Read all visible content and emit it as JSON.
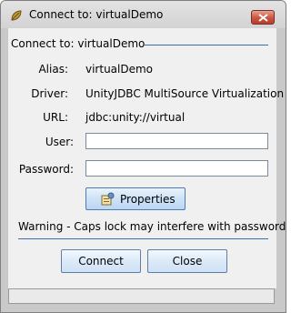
{
  "window": {
    "title": "Connect to: virtualDemo",
    "app_icon": "leaf-icon",
    "close_icon": "close-icon"
  },
  "form": {
    "legend": "Connect to: virtualDemo",
    "alias_label": "Alias:",
    "alias_value": "virtualDemo",
    "driver_label": "Driver:",
    "driver_value": "UnityJDBC MultiSource Virtualization",
    "url_label": "URL:",
    "url_value": "jdbc:unity://virtual",
    "user_label": "User:",
    "user_value": "",
    "password_label": "Password:",
    "password_value": "",
    "properties_label": "Properties",
    "properties_icon": "properties-icon",
    "warning": "Warning - Caps lock may interfere with passwords"
  },
  "actions": {
    "connect_label": "Connect",
    "close_label": "Close"
  },
  "status": {
    "text": ""
  },
  "colors": {
    "accent_line": "#3f6ea8",
    "close_button": "#c9553f",
    "button_fill": "#dceaf8"
  }
}
